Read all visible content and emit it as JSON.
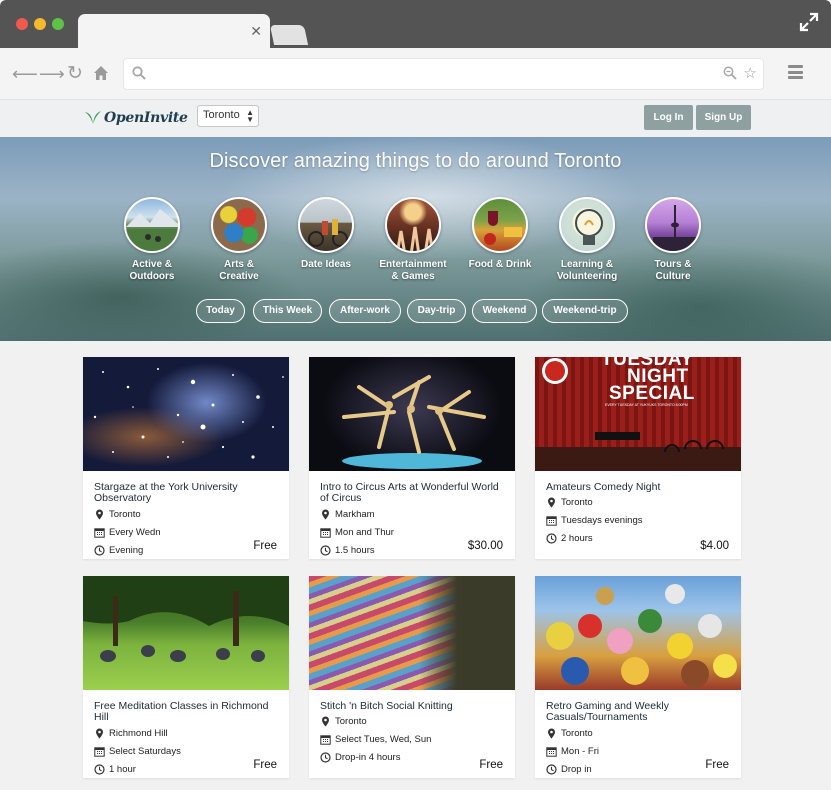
{
  "header": {
    "city": "Toronto",
    "login_label": "Log In",
    "signup_label": "Sign Up"
  },
  "hero": {
    "title": "Discover amazing things to do around Toronto",
    "categories": [
      {
        "line1": "Active &",
        "line2": "Outdoors"
      },
      {
        "line1": "Arts &",
        "line2": "Creative"
      },
      {
        "line1": "Date Ideas",
        "line2": ""
      },
      {
        "line1": "Entertainment",
        "line2": "& Games"
      },
      {
        "line1": "Food & Drink",
        "line2": ""
      },
      {
        "line1": "Learning &",
        "line2": "Volunteering"
      },
      {
        "line1": "Tours &",
        "line2": "Culture"
      }
    ],
    "filters": [
      "Today",
      "This Week",
      "After-work",
      "Day-trip",
      "Weekend",
      "Weekend-trip"
    ]
  },
  "listings": [
    {
      "title": "Stargaze at the York University Observatory",
      "location": "Toronto",
      "schedule": "Every Wedn",
      "duration": "Evening",
      "price": "Free"
    },
    {
      "title": "Intro to Circus Arts at Wonderful World of Circus",
      "location": "Markham",
      "schedule": "Mon and Thur",
      "duration": "1.5 hours",
      "price": "$30.00"
    },
    {
      "title": "Amateurs Comedy Night",
      "location": "Toronto",
      "schedule": "Tuesdays evenings",
      "duration": "2 hours",
      "price": "$4.00",
      "image_text": {
        "big1": "TUESDAY",
        "big2": "NIGHT",
        "big3": "SPECIAL",
        "small": "EVERY TUESDAY AT YUKYUKS TORONTO 8:00PM"
      }
    },
    {
      "title": "Free Meditation Classes in Richmond Hill",
      "location": "Richmond Hill",
      "schedule": "Select Saturdays",
      "duration": "1 hour",
      "price": "Free"
    },
    {
      "title": "Stitch 'n Bitch Social Knitting",
      "location": "Toronto",
      "schedule": "Select Tues, Wed, Sun",
      "duration": "Drop-in 4 hours",
      "price": "Free"
    },
    {
      "title": "Retro Gaming and Weekly Casuals/Tournaments",
      "location": "Toronto",
      "schedule": "Mon - Fri",
      "duration": "Drop in",
      "price": "Free"
    }
  ],
  "icons": {
    "location": "map-pin-icon",
    "schedule": "calendar-icon",
    "duration": "clock-icon"
  },
  "colors": {
    "button": "#8fa0a0",
    "brand_green": "#2e9a4e",
    "brand_text": "#1f3d4f"
  }
}
